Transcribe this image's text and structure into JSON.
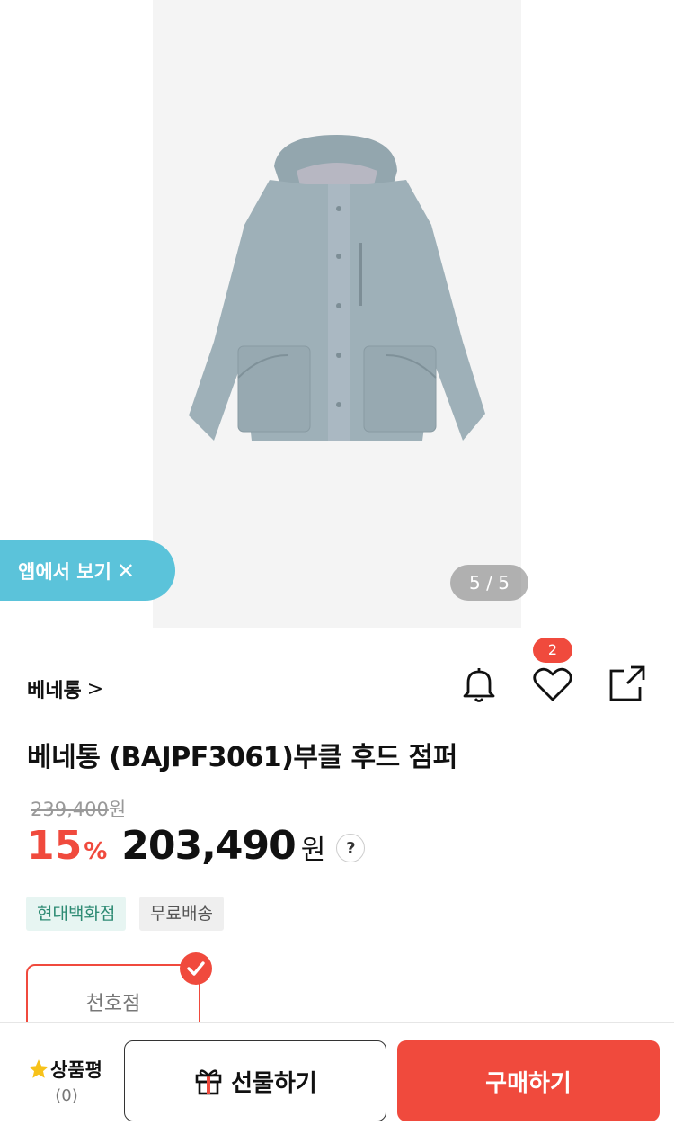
{
  "gallery": {
    "counter": "5 / 5"
  },
  "app_banner": {
    "label": "앱에서 보기",
    "close": "✕"
  },
  "brand": {
    "name": "베네통",
    "chevron": ">"
  },
  "actions": {
    "wishlist_count": "2",
    "icons": [
      "bell-icon",
      "heart-icon",
      "share-icon"
    ]
  },
  "product": {
    "title": "베네통 (BAJPF3061)부클 후드 점퍼",
    "original_price": "239,400",
    "original_unit": "원",
    "discount": "15",
    "discount_unit": "%",
    "price": "203,490",
    "price_unit": "원",
    "help": "?"
  },
  "tags": [
    "현대백화점",
    "무료배송"
  ],
  "store": {
    "name": "천호점"
  },
  "bottom": {
    "review_label": "상품평",
    "review_count": "(0)",
    "gift_label": "선물하기",
    "buy_label": "구매하기"
  },
  "colors": {
    "accent": "#f04a3d",
    "banner": "#5bc3da",
    "jacket": "#9eb0b8"
  }
}
